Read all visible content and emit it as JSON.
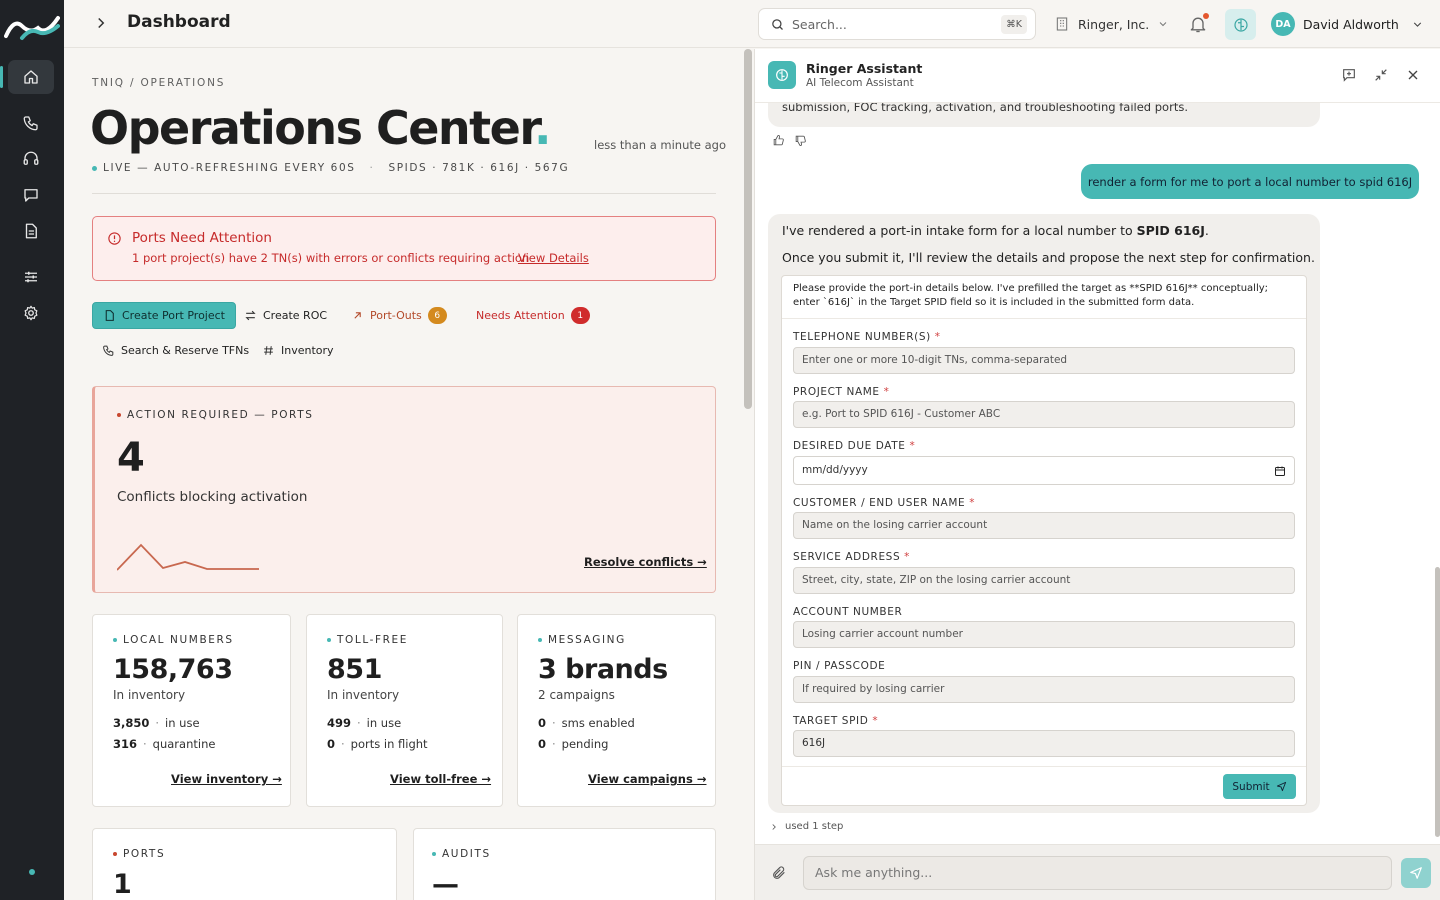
{
  "header": {
    "title": "Dashboard",
    "search_placeholder": "Search...",
    "shortcut": "⌘K",
    "org": "Ringer, Inc.",
    "user_initials": "DA",
    "user_name": "David Aldworth"
  },
  "sidebar": {
    "items": [
      {
        "name": "home",
        "icon": "home-icon",
        "active": true
      },
      {
        "name": "calls",
        "icon": "phone-icon"
      },
      {
        "name": "support",
        "icon": "headset-icon"
      },
      {
        "name": "messages",
        "icon": "chat-icon"
      },
      {
        "name": "documents",
        "icon": "document-icon"
      },
      {
        "name": "settings-sliders",
        "icon": "sliders-icon"
      },
      {
        "name": "settings",
        "icon": "gear-icon"
      }
    ]
  },
  "main": {
    "breadcrumb": "TNIQ / OPERATIONS",
    "title": "Operations Center",
    "title_dot": ".",
    "updated": "less than a minute ago",
    "live": "LIVE — AUTO-REFRESHING EVERY 60S",
    "spids": "SPIDS · 781K · 616J · 567G",
    "alert": {
      "title": "Ports Need Attention",
      "body": "1 port project(s) have 2 TN(s) with errors or conflicts requiring action",
      "link": "View Details"
    },
    "actions": {
      "create_port": "Create Port Project",
      "create_roc": "Create ROC",
      "port_outs": "Port-Outs",
      "port_outs_count": "6",
      "needs_attention": "Needs Attention",
      "needs_attention_count": "1",
      "search_tfns": "Search & Reserve TFNs",
      "inventory": "Inventory"
    },
    "action_card": {
      "label": "ACTION REQUIRED — PORTS",
      "value": "4",
      "desc": "Conflicts blocking activation",
      "link": "Resolve conflicts →"
    },
    "cards": [
      {
        "label": "LOCAL NUMBERS",
        "value": "158,763",
        "sub": "In inventory",
        "s1_val": "3,850",
        "s1_lbl": "in use",
        "s2_val": "316",
        "s2_lbl": "quarantine",
        "link": "View inventory →"
      },
      {
        "label": "TOLL-FREE",
        "value": "851",
        "sub": "In inventory",
        "s1_val": "499",
        "s1_lbl": "in use",
        "s2_val": "0",
        "s2_lbl": "ports in flight",
        "link": "View toll-free →"
      },
      {
        "label": "MESSAGING",
        "value": "3 brands",
        "sub": "2 campaigns",
        "s1_val": "0",
        "s1_lbl": "sms enabled",
        "s2_val": "0",
        "s2_lbl": "pending",
        "link": "View campaigns →"
      }
    ],
    "ports": {
      "label": "PORTS",
      "value": "1"
    },
    "audits": {
      "label": "AUDITS",
      "value": "—"
    }
  },
  "assistant": {
    "title": "Ringer Assistant",
    "subtitle": "AI Telecom Assistant",
    "prev_msg": "submission, FOC tracking, activation, and troubleshooting failed ports.",
    "user_msg": "render a form for me to port a local number to spid 616J",
    "bot_p1_pre": "I've rendered a port-in intake form for a local number to ",
    "bot_p1_bold": "SPID 616J",
    "bot_p1_post": ".",
    "bot_p2": "Once you submit it, I'll review the details and propose the next step for confirmation.",
    "form_note": "Please provide the port-in details below. I've prefilled the target as **SPID 616J** conceptually; enter `616J` in the Target SPID field so it is included in the submitted form data.",
    "fields": [
      {
        "label": "TELEPHONE NUMBER(S)",
        "required": "*",
        "placeholder": "Enter one or more 10-digit TNs, comma-separated"
      },
      {
        "label": "PROJECT NAME",
        "required": "*",
        "placeholder": "e.g. Port to SPID 616J - Customer ABC"
      },
      {
        "label": "DESIRED DUE DATE",
        "required": "*",
        "placeholder": "mm/dd/yyyy"
      },
      {
        "label": "CUSTOMER / END USER NAME",
        "required": "*",
        "placeholder": "Name on the losing carrier account"
      },
      {
        "label": "SERVICE ADDRESS",
        "required": "*",
        "placeholder": "Street, city, state, ZIP on the losing carrier account"
      },
      {
        "label": "ACCOUNT NUMBER",
        "required": "",
        "placeholder": "Losing carrier account number"
      },
      {
        "label": "PIN / PASSCODE",
        "required": "",
        "placeholder": "If required by losing carrier"
      },
      {
        "label": "TARGET SPID",
        "required": "*",
        "value": "616J"
      }
    ],
    "submit": "Submit",
    "used_steps": "used 1 step",
    "ask_placeholder": "Ask me anything..."
  },
  "colors": {
    "accent": "#47b8b4",
    "alert": "#c62b2b",
    "sidebar": "#1f2226"
  }
}
